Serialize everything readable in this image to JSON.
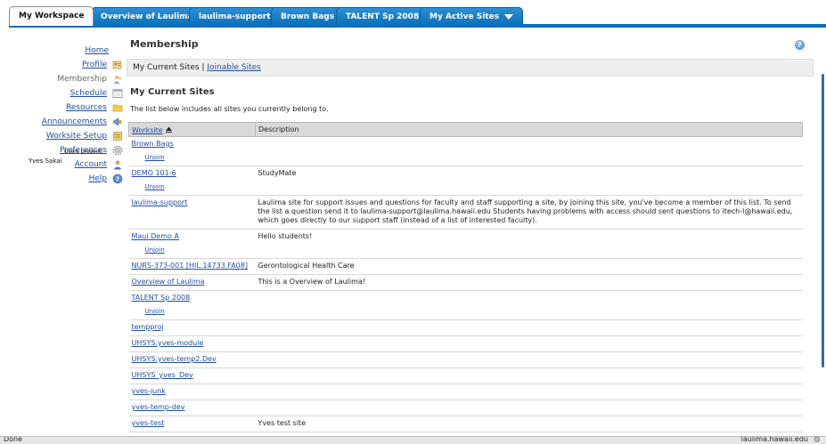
{
  "tabs": [
    {
      "label": "My Workspace",
      "active": true
    },
    {
      "label": "Overview of Laulima",
      "active": false
    },
    {
      "label": "laulima-support",
      "active": false
    },
    {
      "label": "Brown Bags",
      "active": false
    },
    {
      "label": "TALENT Sp 2008",
      "active": false
    },
    {
      "label": "My Active Sites",
      "active": false,
      "dropdown": true
    }
  ],
  "tool_menu": [
    {
      "label": "Home",
      "icon": "home-icon",
      "current": false
    },
    {
      "label": "Profile",
      "icon": "profile-icon",
      "current": false
    },
    {
      "label": "Membership",
      "icon": "membership-icon",
      "current": true
    },
    {
      "label": "Schedule",
      "icon": "calendar-icon",
      "current": false
    },
    {
      "label": "Resources",
      "icon": "folder-icon",
      "current": false
    },
    {
      "label": "Announcements",
      "icon": "megaphone-icon",
      "current": false
    },
    {
      "label": "Worksite Setup",
      "icon": "setup-icon",
      "current": false
    },
    {
      "label": "Preferences",
      "icon": "gear-icon",
      "current": false
    },
    {
      "label": "Account",
      "icon": "account-icon",
      "current": false
    },
    {
      "label": "Help",
      "icon": "help-icon",
      "current": false
    }
  ],
  "presence": {
    "heading": "Users present:",
    "user": "Yves Sakai"
  },
  "main": {
    "title": "Membership",
    "subnav": {
      "current": "My Current Sites",
      "separator": "|",
      "link": "Joinable Sites"
    },
    "section_title": "My Current Sites",
    "instructions": "The list below includes all sites you currently belong to.",
    "table": {
      "columns": [
        "Worksite",
        "Description"
      ],
      "unjoin_label": "Unjoin",
      "rows": [
        {
          "site": "Brown Bags",
          "desc": "",
          "unjoin": true
        },
        {
          "site": "DEMO 101-6",
          "desc": "StudyMate",
          "unjoin": true
        },
        {
          "site": "laulima-support",
          "desc": "Laulima site for support issues and questions for faculty and staff supporting a site, by joining this site, you've become a member of this list. To send the list a question send it to laulima-support@laulima.hawaii.edu Students having problems with access should sent questions to itech-l@hawaii.edu, which goes directly to our support staff (instead of a list of interested faculty).",
          "unjoin": false
        },
        {
          "site": "Maui Demo A",
          "desc": "Hello students!",
          "unjoin": true
        },
        {
          "site": "NURS-373-001 [HIL.14733.FA08]",
          "desc": "Gerontological Health Care",
          "unjoin": false
        },
        {
          "site": "Overview of Laulima",
          "desc": "This is a Overview of Laulima!",
          "unjoin": false
        },
        {
          "site": "TALENT Sp 2008",
          "desc": "",
          "unjoin": true
        },
        {
          "site": "tempproj",
          "desc": "",
          "unjoin": false
        },
        {
          "site": "UHSYS.yves-module",
          "desc": "",
          "unjoin": false
        },
        {
          "site": "UHSYS.yves-temp2.Dev",
          "desc": "",
          "unjoin": false
        },
        {
          "site": "UHSYS_yves_Dev",
          "desc": "",
          "unjoin": false
        },
        {
          "site": "yves-junk",
          "desc": "",
          "unjoin": false
        },
        {
          "site": "yves-temp-dev",
          "desc": "",
          "unjoin": false
        },
        {
          "site": "yves-test",
          "desc": "Yves test site",
          "unjoin": false
        }
      ]
    }
  },
  "status_bar": {
    "left": "Done",
    "right": "laulima.hawaii.edu"
  },
  "colors": {
    "tab_blue": "#0a6fb8",
    "link": "#1f4fa6",
    "header_gray": "#d9d9d9"
  }
}
